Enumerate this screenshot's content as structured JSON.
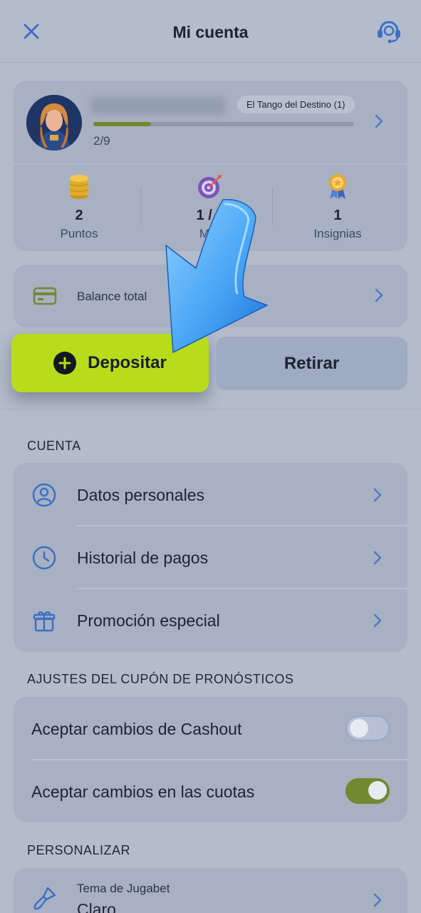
{
  "header": {
    "title": "Mi cuenta"
  },
  "profile": {
    "rank_badge": "El Tango del Destino (1)",
    "progress_text": "2/9",
    "progress_value": 0.22,
    "stats": [
      {
        "value": "2",
        "label": "Puntos",
        "icon": "coins-icon"
      },
      {
        "value": "1 / 1",
        "label": "Misi",
        "icon": "target-icon"
      },
      {
        "value": "1",
        "label": "Insignias",
        "icon": "medal-icon"
      }
    ]
  },
  "balance": {
    "label": "Balance total"
  },
  "actions": {
    "deposit_label": "Depositar",
    "withdraw_label": "Retirar"
  },
  "account": {
    "title": "CUENTA",
    "items": [
      {
        "label": "Datos personales",
        "icon": "user-circle-icon"
      },
      {
        "label": "Historial de pagos",
        "icon": "clock-icon"
      },
      {
        "label": "Promoción especial",
        "icon": "gift-icon"
      }
    ]
  },
  "coupon": {
    "title": "AJUSTES DEL CUPÓN DE PRONÓSTICOS",
    "items": [
      {
        "label": "Aceptar cambios de Cashout",
        "enabled": false
      },
      {
        "label": "Aceptar cambios en las cuotas",
        "enabled": true
      }
    ]
  },
  "personalize": {
    "title": "PERSONALIZAR",
    "theme_label": "Tema de Jugabet",
    "theme_value": "Claro"
  },
  "colors": {
    "background": "#b3bccb",
    "card": "#a8b1c2",
    "accent_primary": "#b8dc1c",
    "accent_icon": "#3d6fc7",
    "toggle_on": "#6f8a2f"
  }
}
